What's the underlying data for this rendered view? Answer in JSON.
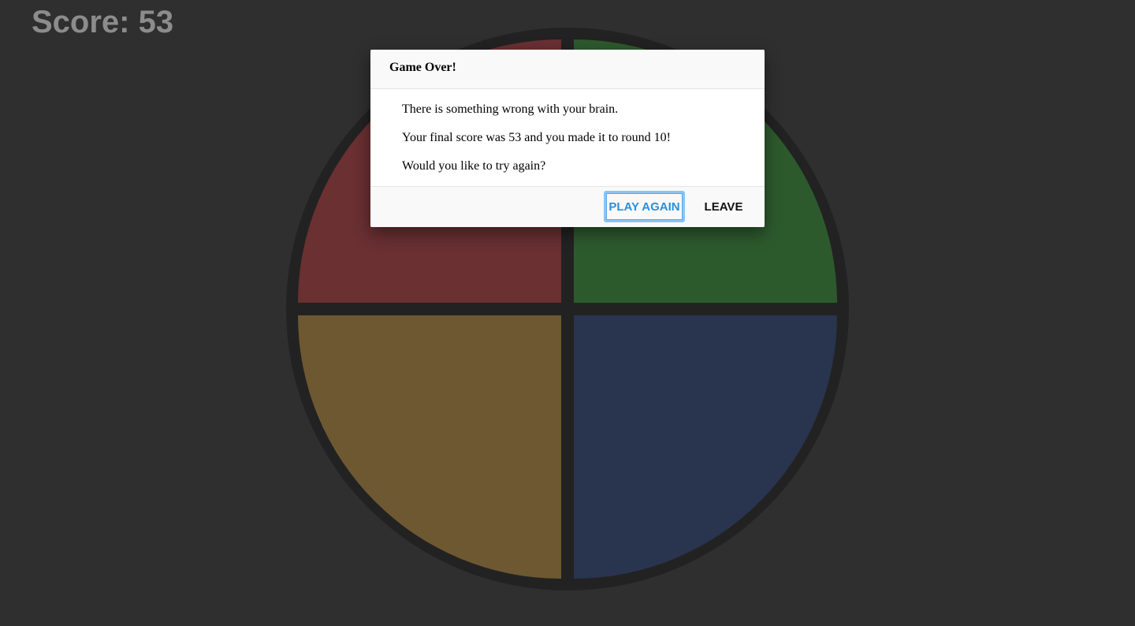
{
  "score": {
    "text": "Score: 53"
  },
  "board": {
    "pads": [
      {
        "name": "red",
        "color": "#6a3032"
      },
      {
        "name": "green",
        "color": "#2d5a2d"
      },
      {
        "name": "yellow",
        "color": "#6d5831"
      },
      {
        "name": "blue",
        "color": "#29344f"
      }
    ],
    "rim_color": "#222222"
  },
  "dialog": {
    "title": "Game Over!",
    "lines": [
      "There is something wrong with your brain.",
      "Your final score was 53 and you made it to round 10!",
      "Would you like to try again?"
    ],
    "play_again_label": "Play Again",
    "leave_label": "Leave"
  },
  "colors": {
    "background": "#2f2f2f",
    "score_text": "#8c8c8c",
    "primary_button_text": "#2b8fd6",
    "focus_ring": "#8cc4f2"
  }
}
